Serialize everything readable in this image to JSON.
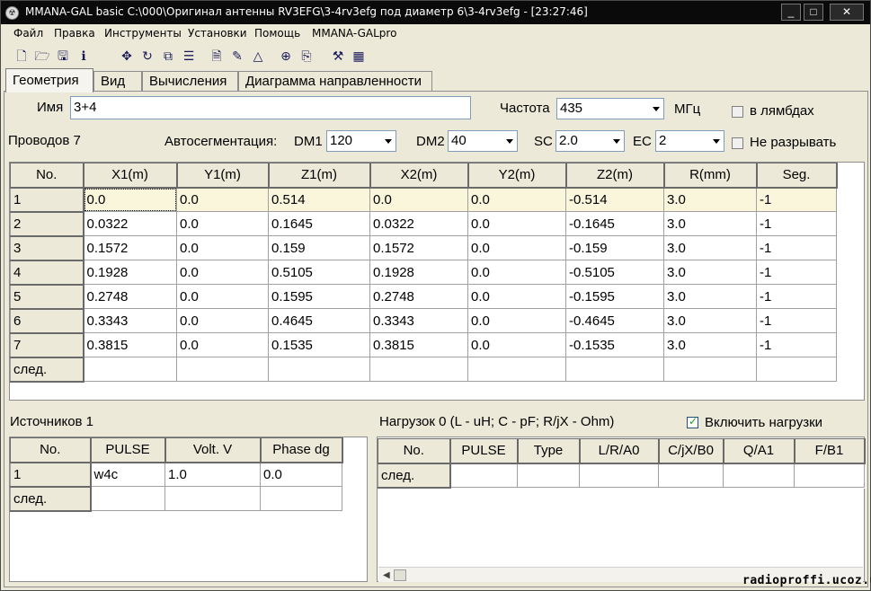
{
  "window": {
    "title": "MMANA-GAL basic C:\\000\\Оригинал антенны RV3EFG\\3-4rv3efg под диаметр 6\\3-4rv3efg - [23:27:46]",
    "buttons": {
      "minimize": "_",
      "maximize": "□",
      "close": "✕"
    }
  },
  "menu": [
    "Файл",
    "Правка",
    "Инструменты",
    "Установки",
    "Помощь",
    "MMANA-GALpro"
  ],
  "toolbar": [
    "new-file-icon",
    "open-folder-icon",
    "save-icon",
    "info-icon",
    "move-icon",
    "rotate-icon",
    "copy-scale-icon",
    "list-icon",
    "document-icon",
    "pen-icon",
    "triangle-icon",
    "crosshair-icon",
    "copy-icon",
    "tools-icon",
    "calculator-icon"
  ],
  "tabs": [
    "Геометрия",
    "Вид",
    "Вычисления",
    "Диаграмма направленности"
  ],
  "geometry": {
    "name_label": "Имя",
    "name_value": "3+4",
    "freq_label": "Частота",
    "freq_value": "435",
    "freq_unit": "МГц",
    "lambda_label": "в лямбдах",
    "wires_label": "Проводов 7",
    "autoseg_label": "Автосегментация:",
    "dm1_label": "DM1",
    "dm1_value": "120",
    "dm2_label": "DM2",
    "dm2_value": "40",
    "sc_label": "SC",
    "sc_value": "2.0",
    "ec_label": "EC",
    "ec_value": "2",
    "nobreak_label": "Не разрывать"
  },
  "wires_table": {
    "headers": [
      "No.",
      "X1(m)",
      "Y1(m)",
      "Z1(m)",
      "X2(m)",
      "Y2(m)",
      "Z2(m)",
      "R(mm)",
      "Seg."
    ],
    "rows": [
      [
        "1",
        "0.0",
        "0.0",
        "0.514",
        "0.0",
        "0.0",
        "-0.514",
        "3.0",
        "-1"
      ],
      [
        "2",
        "0.0322",
        "0.0",
        "0.1645",
        "0.0322",
        "0.0",
        "-0.1645",
        "3.0",
        "-1"
      ],
      [
        "3",
        "0.1572",
        "0.0",
        "0.159",
        "0.1572",
        "0.0",
        "-0.159",
        "3.0",
        "-1"
      ],
      [
        "4",
        "0.1928",
        "0.0",
        "0.5105",
        "0.1928",
        "0.0",
        "-0.5105",
        "3.0",
        "-1"
      ],
      [
        "5",
        "0.2748",
        "0.0",
        "0.1595",
        "0.2748",
        "0.0",
        "-0.1595",
        "3.0",
        "-1"
      ],
      [
        "6",
        "0.3343",
        "0.0",
        "0.4645",
        "0.3343",
        "0.0",
        "-0.4645",
        "3.0",
        "-1"
      ],
      [
        "7",
        "0.3815",
        "0.0",
        "0.1535",
        "0.3815",
        "0.0",
        "-0.1535",
        "3.0",
        "-1"
      ]
    ],
    "next_label": "след."
  },
  "sources": {
    "label": "Источников 1",
    "headers": [
      "No.",
      "PULSE",
      "Volt. V",
      "Phase dg"
    ],
    "rows": [
      [
        "1",
        "w4c",
        "1.0",
        "0.0"
      ]
    ],
    "next_label": "след."
  },
  "loads": {
    "label": "Нагрузок 0 (L - uH; C - pF; R/jX - Ohm)",
    "enable_label": "Включить нагрузки",
    "headers": [
      "No.",
      "PULSE",
      "Type",
      "L/R/A0",
      "C/jX/B0",
      "Q/A1",
      "F/B1"
    ],
    "next_label": "след."
  },
  "watermark": "radioproffi.ucoz.ua"
}
